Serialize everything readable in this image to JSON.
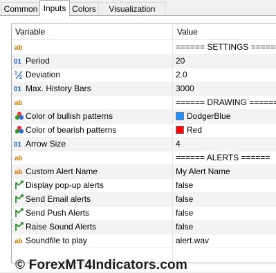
{
  "tabs": [
    {
      "label": "Common"
    },
    {
      "label": "Inputs"
    },
    {
      "label": "Colors"
    },
    {
      "label": "Visualization"
    }
  ],
  "grid": {
    "header_variable": "Variable",
    "header_value": "Value",
    "rows": [
      {
        "type": "text",
        "name": "",
        "value": "====== SETTINGS ======"
      },
      {
        "type": "int",
        "name": "Period",
        "value": "20"
      },
      {
        "type": "double",
        "name": "Deviation",
        "value": "2.0"
      },
      {
        "type": "int",
        "name": "Max. History Bars",
        "value": "3000"
      },
      {
        "type": "text",
        "name": "",
        "value": "====== DRAWING  ======"
      },
      {
        "type": "color",
        "name": "Color of bullish patterns",
        "value": "DodgerBlue",
        "color": "#1e90ff"
      },
      {
        "type": "color",
        "name": "Color of bearish patterns",
        "value": "Red",
        "color": "#ff0000"
      },
      {
        "type": "int",
        "name": "Arrow Size",
        "value": "4"
      },
      {
        "type": "text",
        "name": "",
        "value": "====== ALERTS ======"
      },
      {
        "type": "text",
        "name": "Custom Alert Name",
        "value": "My Alert Name"
      },
      {
        "type": "bool",
        "name": "Display pop-up alerts",
        "value": "false"
      },
      {
        "type": "bool",
        "name": "Send Email alerts",
        "value": "false"
      },
      {
        "type": "bool",
        "name": "Send Push Alerts",
        "value": "false"
      },
      {
        "type": "bool",
        "name": "Raise Sound Alerts",
        "value": "false"
      },
      {
        "type": "text",
        "name": "Soundfile to play",
        "value": "alert.wav"
      }
    ]
  },
  "watermark": "© ForexMT4Indicators.com",
  "colors": {
    "dodger_blue": "#1e90ff",
    "red": "#ff0000",
    "icon_blue": "#1c5fb8",
    "icon_green": "#2c8f2c",
    "icon_orange": "#c87800"
  }
}
